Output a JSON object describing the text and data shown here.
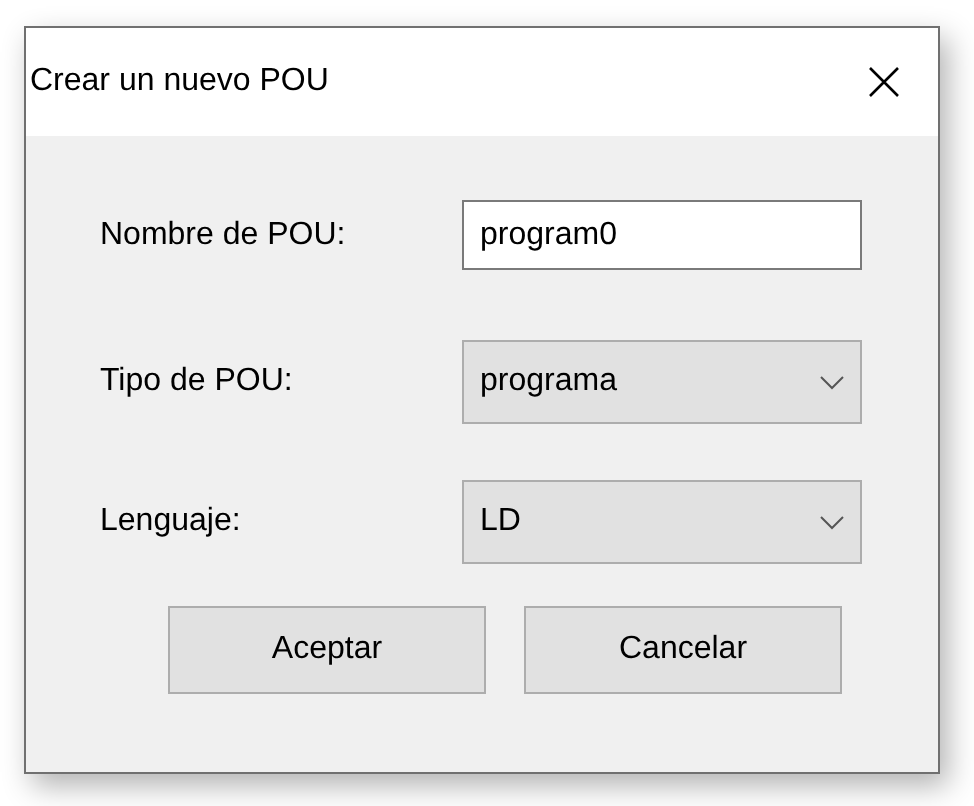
{
  "dialog": {
    "title": "Crear un nuevo POU",
    "fields": [
      {
        "kind": "text",
        "label": "Nombre de POU:",
        "value": "program0"
      },
      {
        "kind": "select",
        "label": "Tipo de POU:",
        "value": "programa"
      },
      {
        "kind": "select",
        "label": "Lenguaje:",
        "value": "LD"
      }
    ],
    "buttons": [
      "Aceptar",
      "Cancelar"
    ]
  }
}
